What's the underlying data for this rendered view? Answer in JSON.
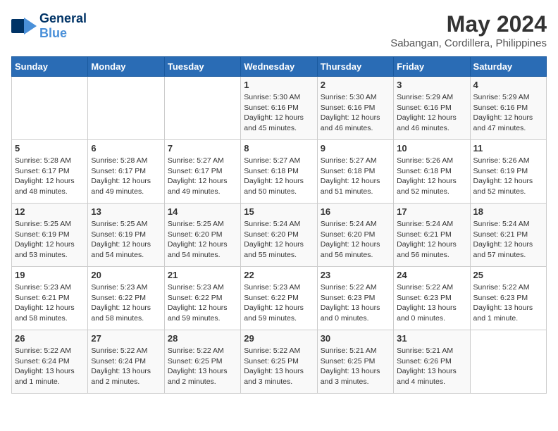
{
  "logo": {
    "general": "General",
    "blue": "Blue"
  },
  "title": {
    "month_year": "May 2024",
    "location": "Sabangan, Cordillera, Philippines"
  },
  "headers": [
    "Sunday",
    "Monday",
    "Tuesday",
    "Wednesday",
    "Thursday",
    "Friday",
    "Saturday"
  ],
  "weeks": [
    [
      {
        "day": "",
        "content": ""
      },
      {
        "day": "",
        "content": ""
      },
      {
        "day": "",
        "content": ""
      },
      {
        "day": "1",
        "content": "Sunrise: 5:30 AM\nSunset: 6:16 PM\nDaylight: 12 hours\nand 45 minutes."
      },
      {
        "day": "2",
        "content": "Sunrise: 5:30 AM\nSunset: 6:16 PM\nDaylight: 12 hours\nand 46 minutes."
      },
      {
        "day": "3",
        "content": "Sunrise: 5:29 AM\nSunset: 6:16 PM\nDaylight: 12 hours\nand 46 minutes."
      },
      {
        "day": "4",
        "content": "Sunrise: 5:29 AM\nSunset: 6:16 PM\nDaylight: 12 hours\nand 47 minutes."
      }
    ],
    [
      {
        "day": "5",
        "content": "Sunrise: 5:28 AM\nSunset: 6:17 PM\nDaylight: 12 hours\nand 48 minutes."
      },
      {
        "day": "6",
        "content": "Sunrise: 5:28 AM\nSunset: 6:17 PM\nDaylight: 12 hours\nand 49 minutes."
      },
      {
        "day": "7",
        "content": "Sunrise: 5:27 AM\nSunset: 6:17 PM\nDaylight: 12 hours\nand 49 minutes."
      },
      {
        "day": "8",
        "content": "Sunrise: 5:27 AM\nSunset: 6:18 PM\nDaylight: 12 hours\nand 50 minutes."
      },
      {
        "day": "9",
        "content": "Sunrise: 5:27 AM\nSunset: 6:18 PM\nDaylight: 12 hours\nand 51 minutes."
      },
      {
        "day": "10",
        "content": "Sunrise: 5:26 AM\nSunset: 6:18 PM\nDaylight: 12 hours\nand 52 minutes."
      },
      {
        "day": "11",
        "content": "Sunrise: 5:26 AM\nSunset: 6:19 PM\nDaylight: 12 hours\nand 52 minutes."
      }
    ],
    [
      {
        "day": "12",
        "content": "Sunrise: 5:25 AM\nSunset: 6:19 PM\nDaylight: 12 hours\nand 53 minutes."
      },
      {
        "day": "13",
        "content": "Sunrise: 5:25 AM\nSunset: 6:19 PM\nDaylight: 12 hours\nand 54 minutes."
      },
      {
        "day": "14",
        "content": "Sunrise: 5:25 AM\nSunset: 6:20 PM\nDaylight: 12 hours\nand 54 minutes."
      },
      {
        "day": "15",
        "content": "Sunrise: 5:24 AM\nSunset: 6:20 PM\nDaylight: 12 hours\nand 55 minutes."
      },
      {
        "day": "16",
        "content": "Sunrise: 5:24 AM\nSunset: 6:20 PM\nDaylight: 12 hours\nand 56 minutes."
      },
      {
        "day": "17",
        "content": "Sunrise: 5:24 AM\nSunset: 6:21 PM\nDaylight: 12 hours\nand 56 minutes."
      },
      {
        "day": "18",
        "content": "Sunrise: 5:24 AM\nSunset: 6:21 PM\nDaylight: 12 hours\nand 57 minutes."
      }
    ],
    [
      {
        "day": "19",
        "content": "Sunrise: 5:23 AM\nSunset: 6:21 PM\nDaylight: 12 hours\nand 58 minutes."
      },
      {
        "day": "20",
        "content": "Sunrise: 5:23 AM\nSunset: 6:22 PM\nDaylight: 12 hours\nand 58 minutes."
      },
      {
        "day": "21",
        "content": "Sunrise: 5:23 AM\nSunset: 6:22 PM\nDaylight: 12 hours\nand 59 minutes."
      },
      {
        "day": "22",
        "content": "Sunrise: 5:23 AM\nSunset: 6:22 PM\nDaylight: 12 hours\nand 59 minutes."
      },
      {
        "day": "23",
        "content": "Sunrise: 5:22 AM\nSunset: 6:23 PM\nDaylight: 13 hours\nand 0 minutes."
      },
      {
        "day": "24",
        "content": "Sunrise: 5:22 AM\nSunset: 6:23 PM\nDaylight: 13 hours\nand 0 minutes."
      },
      {
        "day": "25",
        "content": "Sunrise: 5:22 AM\nSunset: 6:23 PM\nDaylight: 13 hours\nand 1 minute."
      }
    ],
    [
      {
        "day": "26",
        "content": "Sunrise: 5:22 AM\nSunset: 6:24 PM\nDaylight: 13 hours\nand 1 minute."
      },
      {
        "day": "27",
        "content": "Sunrise: 5:22 AM\nSunset: 6:24 PM\nDaylight: 13 hours\nand 2 minutes."
      },
      {
        "day": "28",
        "content": "Sunrise: 5:22 AM\nSunset: 6:25 PM\nDaylight: 13 hours\nand 2 minutes."
      },
      {
        "day": "29",
        "content": "Sunrise: 5:22 AM\nSunset: 6:25 PM\nDaylight: 13 hours\nand 3 minutes."
      },
      {
        "day": "30",
        "content": "Sunrise: 5:21 AM\nSunset: 6:25 PM\nDaylight: 13 hours\nand 3 minutes."
      },
      {
        "day": "31",
        "content": "Sunrise: 5:21 AM\nSunset: 6:26 PM\nDaylight: 13 hours\nand 4 minutes."
      },
      {
        "day": "",
        "content": ""
      }
    ]
  ]
}
